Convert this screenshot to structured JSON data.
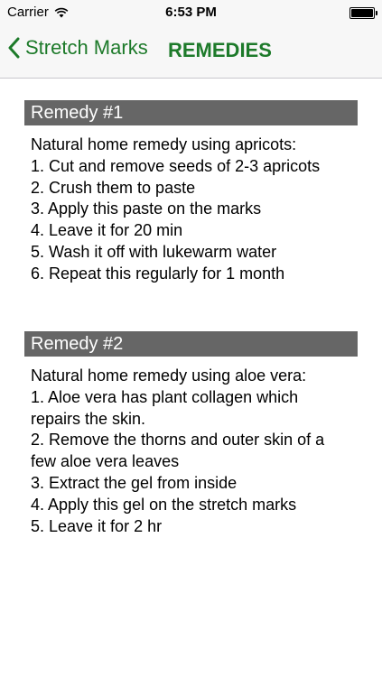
{
  "status_bar": {
    "carrier": "Carrier",
    "time": "6:53 PM",
    "battery_level": 1.0,
    "icons": [
      "wifi-icon",
      "battery-icon"
    ]
  },
  "nav": {
    "back_label": "Stretch Marks",
    "title": "REMEDIES",
    "accent_color": "#1d7a2a",
    "icons": [
      "chevron-left-icon"
    ]
  },
  "remedies": [
    {
      "title": "Remedy #1",
      "lines": [
        "Natural home remedy using apricots:",
        "1. Cut and remove seeds of 2-3 apricots",
        "2. Crush them to paste",
        "3. Apply this paste on the marks",
        "4. Leave it for 20 min",
        "5. Wash it off with lukewarm water",
        "6. Repeat this regularly for 1 month"
      ]
    },
    {
      "title": "Remedy #2",
      "lines": [
        "Natural home remedy using aloe vera:",
        "1. Aloe vera has plant collagen which repairs the skin.",
        "2. Remove the thorns and outer skin of a few aloe vera leaves",
        "3. Extract the gel from inside",
        "4. Apply this gel on the stretch marks",
        "5. Leave it for 2 hr"
      ]
    }
  ],
  "colors": {
    "header_bg": "#666666",
    "header_text": "#ffffff",
    "body_text": "#000000"
  }
}
